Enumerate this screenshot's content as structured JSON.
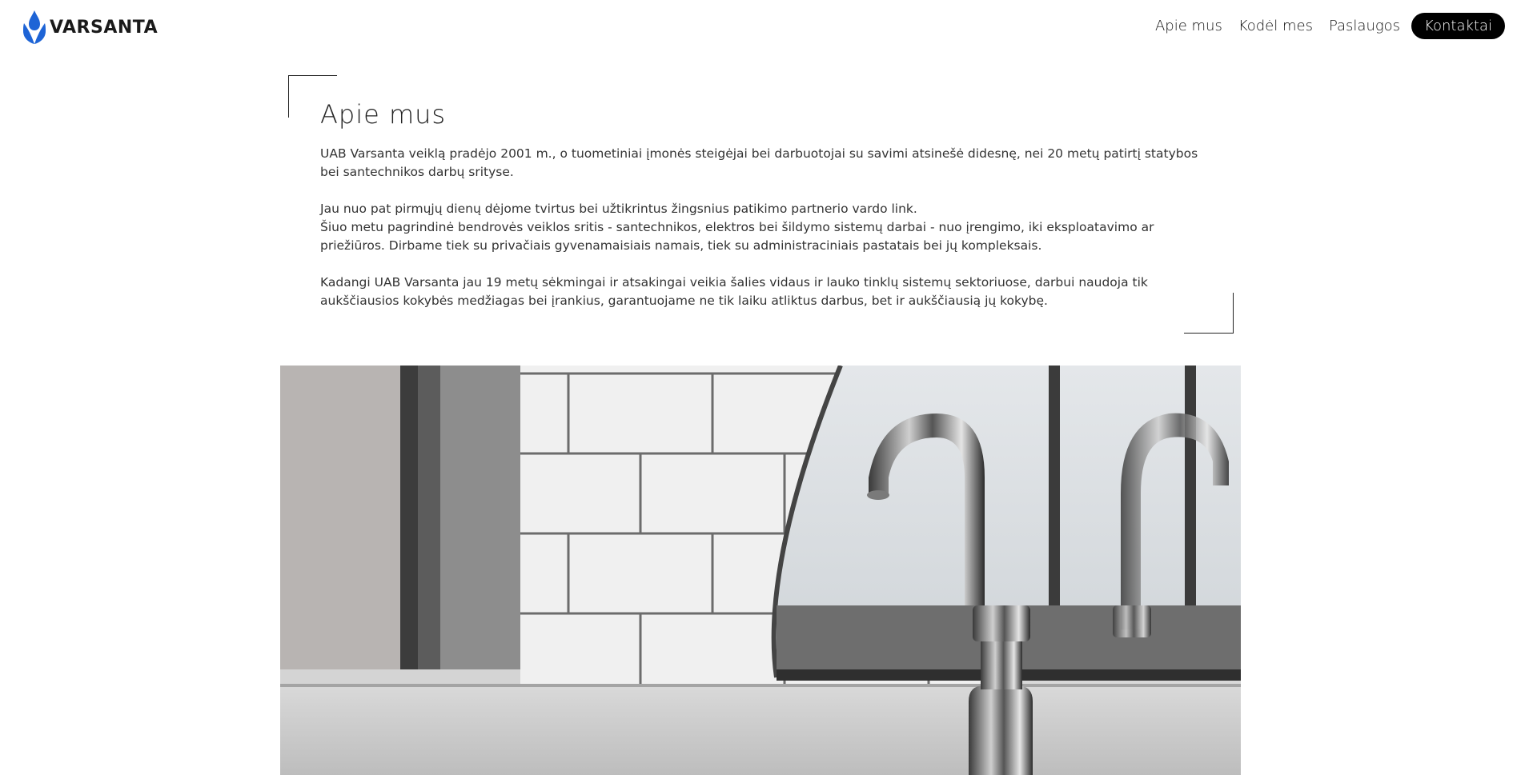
{
  "brand": {
    "name": "VARSANTA",
    "logo_icon": "water-drop-icon",
    "accent": "#1e64d6"
  },
  "nav": {
    "items": [
      {
        "label": "Apie mus"
      },
      {
        "label": "Kodėl mes"
      },
      {
        "label": "Paslaugos"
      },
      {
        "label": "Kontaktai",
        "active": true
      }
    ]
  },
  "about": {
    "title": "Apie mus",
    "paragraphs": [
      "UAB Varsanta veiklą pradėjo 2001 m., o tuometiniai įmonės steigėjai bei darbuotojai su savimi atsinešė didesnę, nei 20 metų patirtį statybos bei santechnikos darbų srityse.",
      "Jau nuo pat pirmųjų dienų dėjome tvirtus bei užtikrintus žingsnius patikimo partnerio vardo link.",
      "Šiuo metu pagrindinė bendrovės veiklos sritis - santechnikos, elektros bei šildymo sistemų darbai - nuo įrengimo, iki eksploatavimo ar priežiūros. Dirbame tiek su privačiais gyvenamaisiais namais, tiek su administraciniais pastatais bei jų kompleksais.",
      "Kadangi UAB Varsanta jau 19 metų sėkmingai ir atsakingai veikia šalies vidaus ir lauko tinklų sistemų sektoriuose, darbui naudoja tik aukščiausios kokybės medžiagas bei įrankius, garantuojame ne tik laiku atliktus darbus, bet ir aukščiausią jų kokybę."
    ]
  },
  "photo": {
    "subject": "chrome-faucet-photo"
  }
}
